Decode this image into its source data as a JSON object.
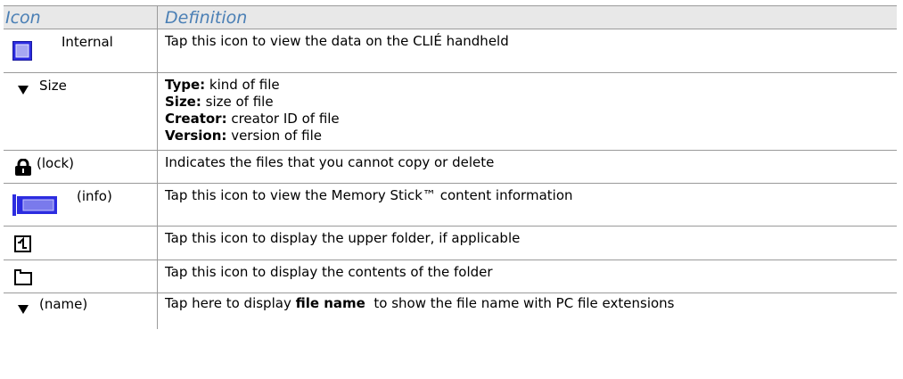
{
  "table": {
    "headers": {
      "icon": "Icon",
      "definition": "Definition"
    },
    "rows": [
      {
        "icon_label": "Internal",
        "icon_name": "internal-memory-icon",
        "definition": "Tap this icon to view the data on the CLIÉ handheld"
      },
      {
        "icon_label": "Size",
        "icon_name": "sort-triangle-icon",
        "lines": [
          {
            "term": "Type:",
            "text": " kind of file"
          },
          {
            "term": "Size:",
            "text": " size of file"
          },
          {
            "term": "Creator:",
            "text": " creator ID of file"
          },
          {
            "term": "Version:",
            "text": " version of file"
          }
        ]
      },
      {
        "icon_label": "(lock)",
        "icon_name": "lock-icon",
        "definition": "Indicates the files that you cannot copy or delete"
      },
      {
        "icon_label": "(info)",
        "icon_name": "memory-stick-info-icon",
        "definition": "Tap this icon to view the Memory Stick™ content information"
      },
      {
        "icon_label": "",
        "icon_name": "upper-folder-icon",
        "definition": "Tap this icon to display the upper folder, if applicable"
      },
      {
        "icon_label": "",
        "icon_name": "folder-icon",
        "definition": "Tap this icon to display the contents of the folder"
      },
      {
        "icon_label": "(name)",
        "icon_name": "sort-triangle-icon",
        "definition_pre": "Tap here to display ",
        "definition_bold": "file name",
        "definition_post": "  to show the file name with PC file extensions"
      }
    ]
  }
}
